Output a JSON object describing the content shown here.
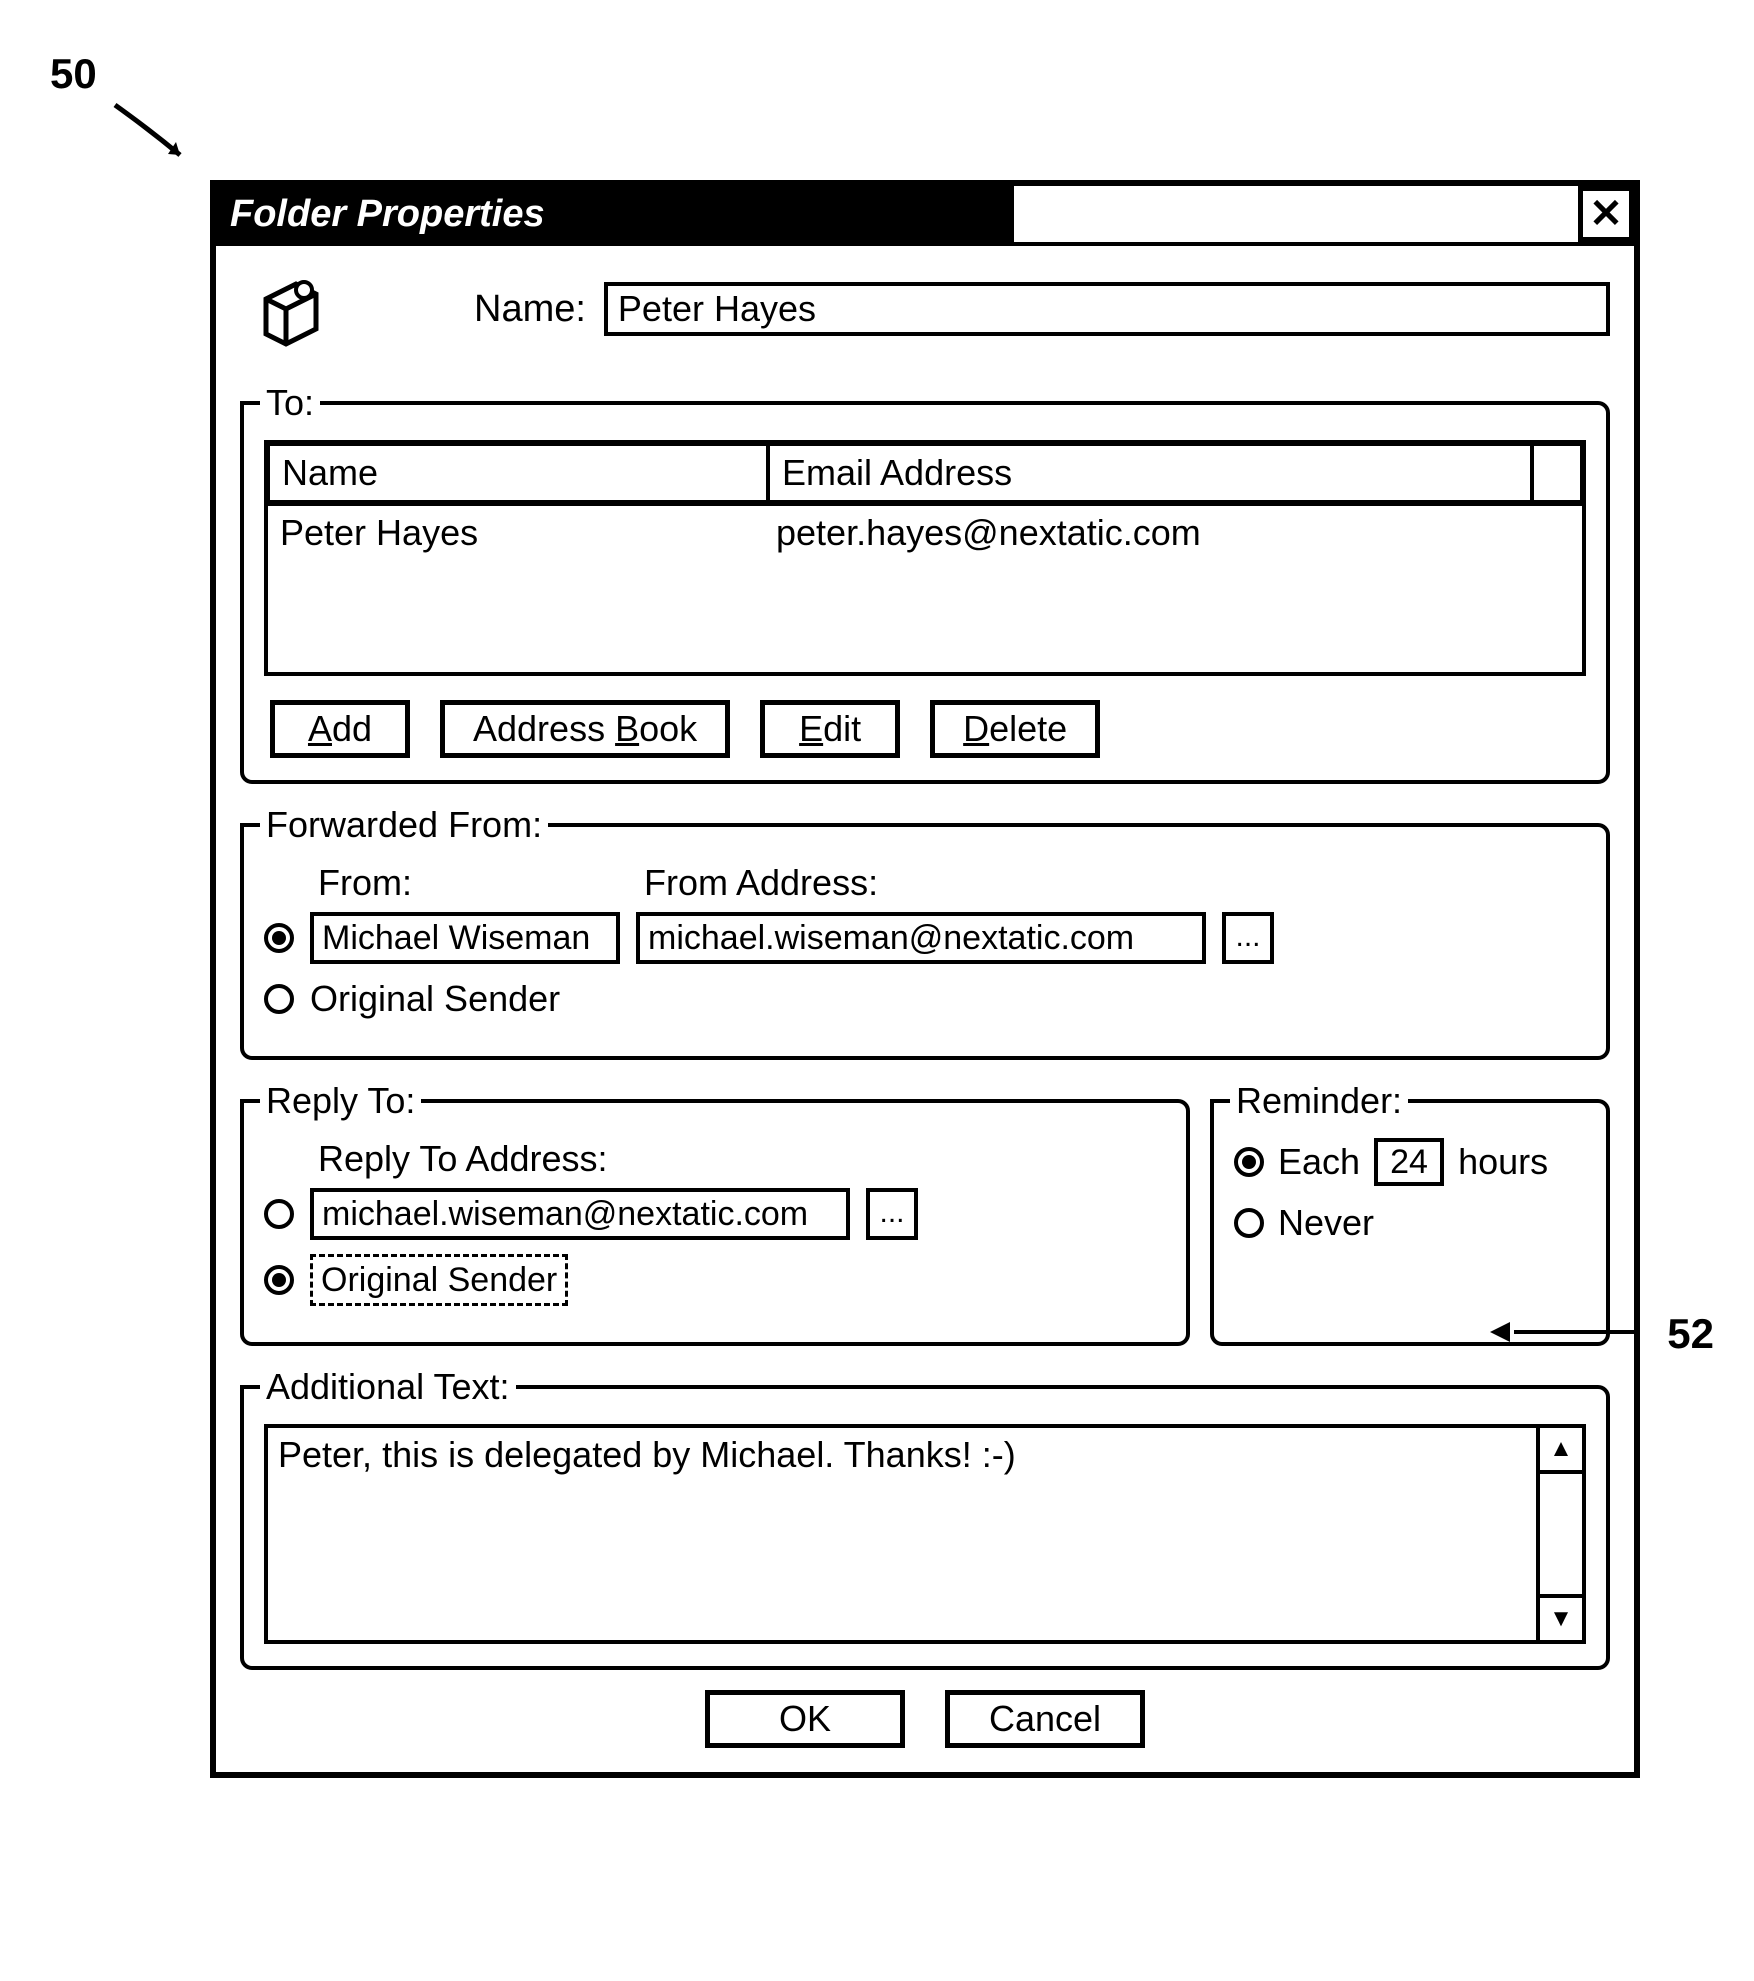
{
  "callouts": {
    "fifty": "50",
    "fiftytwo": "52"
  },
  "window": {
    "title": "Folder Properties",
    "name_label": "Name:",
    "name_value": "Peter Hayes"
  },
  "to": {
    "legend": "To:",
    "headers": {
      "name": "Name",
      "email": "Email Address"
    },
    "row": {
      "name": "Peter Hayes",
      "email": "peter.hayes@nextatic.com"
    },
    "buttons": {
      "add": "Add",
      "address_book": "Address Book",
      "edit": "Edit",
      "delete": "Delete"
    },
    "accel": {
      "add": "A",
      "address_book": "B",
      "edit": "E",
      "delete": "D"
    }
  },
  "forwarded_from": {
    "legend": "Forwarded From:",
    "from_label": "From:",
    "from_address_label": "From Address:",
    "opt_from_name": "Michael Wiseman",
    "opt_from_email": "michael.wiseman@nextatic.com",
    "opt_original_sender": "Original Sender",
    "selected": "from"
  },
  "reply_to": {
    "legend": "Reply To:",
    "address_label": "Reply To Address:",
    "opt_address_value": "michael.wiseman@nextatic.com",
    "opt_original_sender": "Original Sender",
    "selected": "original"
  },
  "reminder": {
    "legend": "Reminder:",
    "opt_each_prefix": "Each",
    "opt_each_value": "24",
    "opt_each_suffix": "hours",
    "opt_never": "Never",
    "selected": "each"
  },
  "additional_text": {
    "legend": "Additional Text:",
    "value": "Peter, this is delegated by Michael. Thanks! :-)"
  },
  "footer": {
    "ok": "OK",
    "cancel": "Cancel"
  },
  "ellipsis": "..."
}
